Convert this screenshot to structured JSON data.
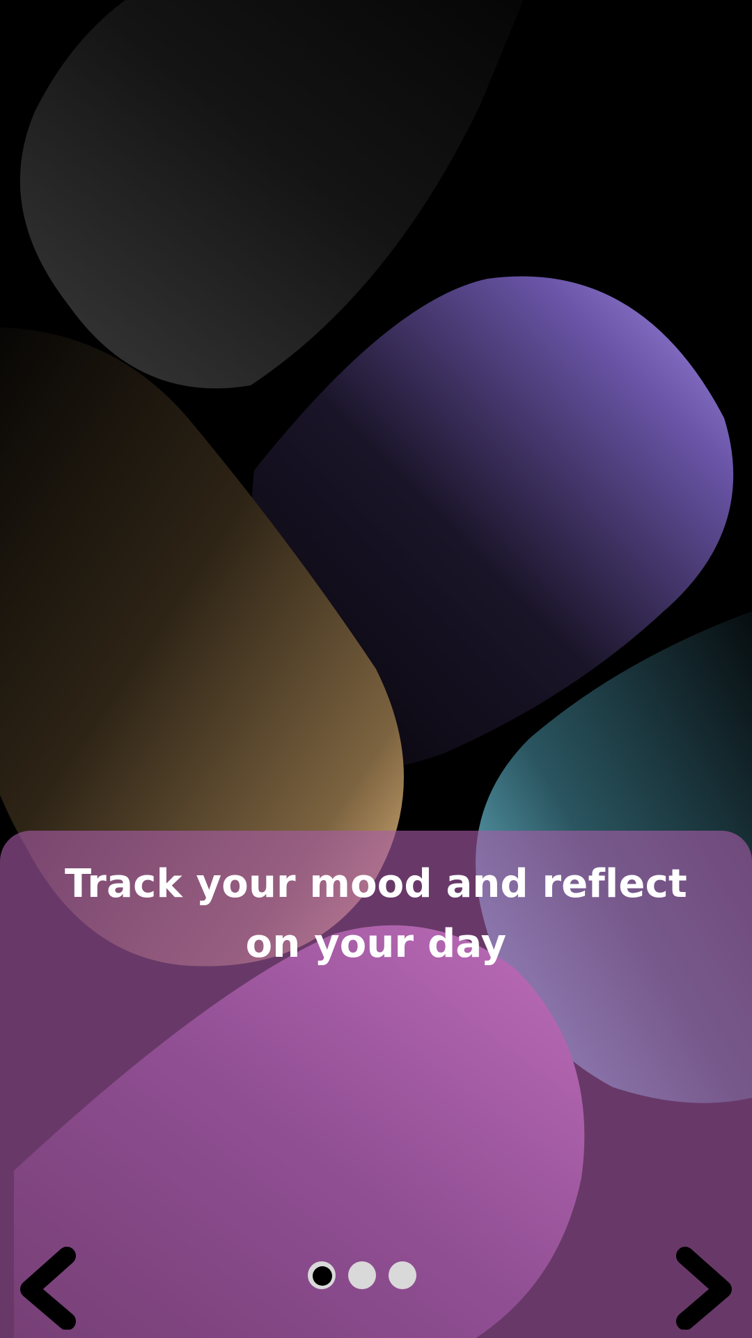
{
  "onboarding": {
    "headline_line1": "Track your mood and reflect",
    "headline_line2": "on your day"
  },
  "pager": {
    "page_count": 3,
    "active_page": 1
  },
  "navigation": {
    "prev_icon": "chevron-left-icon",
    "next_icon": "chevron-right-icon"
  },
  "colors": {
    "sheet_tint": "#a85ca8",
    "headline_text": "#ffffff",
    "dot_inactive": "#d9d9d9",
    "dot_active": "#000000",
    "arrow": "#000000"
  }
}
